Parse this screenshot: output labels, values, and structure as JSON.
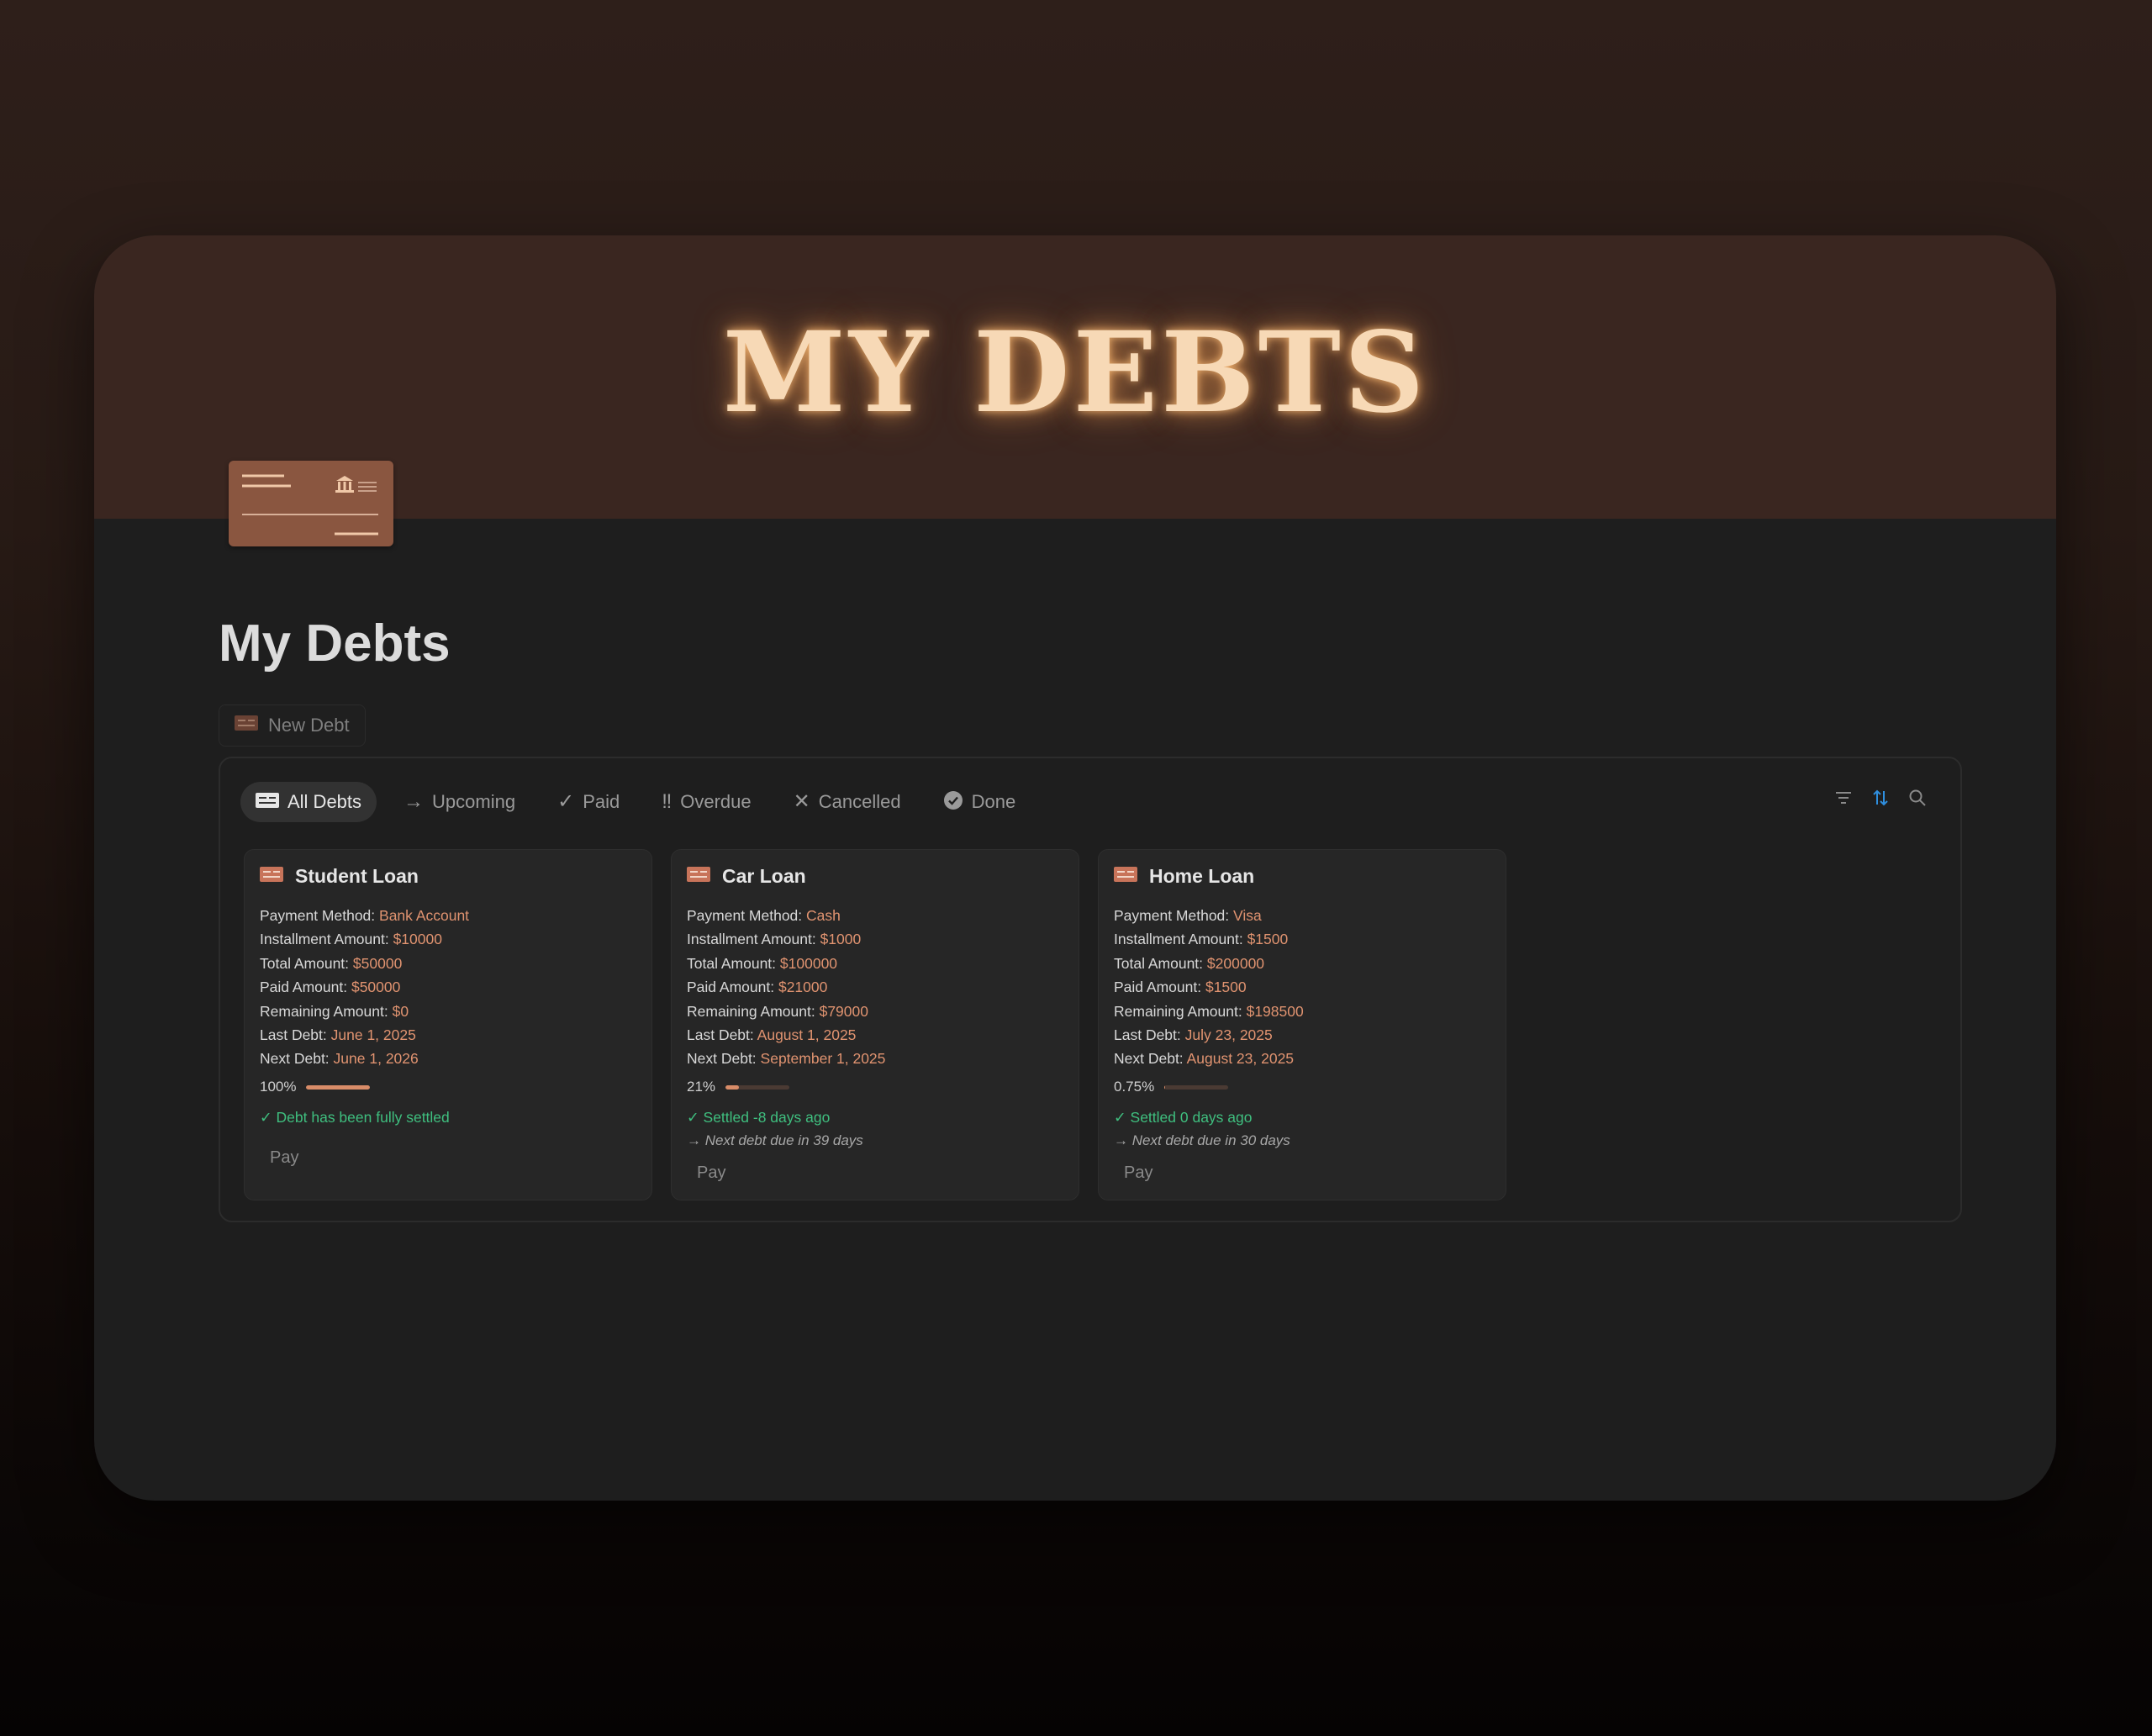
{
  "cover": {
    "title": "MY DEBTS"
  },
  "page": {
    "title": "My Debts",
    "new_button": "New Debt"
  },
  "tabs": [
    {
      "label": "All Debts",
      "icon": "card-icon",
      "active": true
    },
    {
      "label": "Upcoming",
      "icon": "arrow-right-icon",
      "active": false
    },
    {
      "label": "Paid",
      "icon": "check-icon",
      "active": false
    },
    {
      "label": "Overdue",
      "icon": "double-exclamation-icon",
      "active": false
    },
    {
      "label": "Cancelled",
      "icon": "x-icon",
      "active": false
    },
    {
      "label": "Done",
      "icon": "check-circle-icon",
      "active": false
    }
  ],
  "toolbar": {
    "icons": [
      "filter-icon",
      "sort-icon",
      "search-icon"
    ],
    "sort_color": "#2f8fdf"
  },
  "colors": {
    "accent": "#e09370",
    "success": "#3fbf7f",
    "cover": "#3a2620",
    "card": "#262626"
  },
  "cards": [
    {
      "title": "Student Loan",
      "props": [
        {
          "label": "Payment Method: ",
          "value": "Bank Account"
        },
        {
          "label": "Installment Amount: ",
          "value": "$10000"
        },
        {
          "label": "Total Amount: ",
          "value": "$50000"
        },
        {
          "label": "Paid Amount: ",
          "value": "$50000"
        },
        {
          "label": "Remaining Amount: ",
          "value": "$0"
        },
        {
          "label": "Last Debt: ",
          "value": "June 1, 2025"
        },
        {
          "label": "Next Debt: ",
          "value": "June 1, 2026"
        }
      ],
      "progress_label": "100%",
      "progress": 1.0,
      "status": "✓ Debt has been fully settled",
      "next": "",
      "pay": "Pay"
    },
    {
      "title": "Car Loan",
      "props": [
        {
          "label": "Payment Method: ",
          "value": "Cash"
        },
        {
          "label": "Installment Amount: ",
          "value": "$1000"
        },
        {
          "label": "Total Amount: ",
          "value": "$100000"
        },
        {
          "label": "Paid Amount: ",
          "value": "$21000"
        },
        {
          "label": "Remaining Amount: ",
          "value": "$79000"
        },
        {
          "label": "Last Debt: ",
          "value": "August 1, 2025"
        },
        {
          "label": "Next Debt: ",
          "value": "September 1, 2025"
        }
      ],
      "progress_label": "21%",
      "progress": 0.21,
      "status": "✓ Settled -8 days ago",
      "next": "→ Next debt due in 39 days",
      "pay": "Pay"
    },
    {
      "title": "Home Loan",
      "props": [
        {
          "label": "Payment Method: ",
          "value": "Visa"
        },
        {
          "label": "Installment Amount: ",
          "value": "$1500"
        },
        {
          "label": "Total Amount: ",
          "value": "$200000"
        },
        {
          "label": "Paid Amount: ",
          "value": "$1500"
        },
        {
          "label": "Remaining Amount: ",
          "value": "$198500"
        },
        {
          "label": "Last Debt: ",
          "value": "July 23, 2025"
        },
        {
          "label": "Next Debt: ",
          "value": "August 23, 2025"
        }
      ],
      "progress_label": "0.75%",
      "progress": 0.0075,
      "status": "✓ Settled 0 days ago",
      "next": "→ Next debt due in 30 days",
      "pay": "Pay"
    }
  ]
}
